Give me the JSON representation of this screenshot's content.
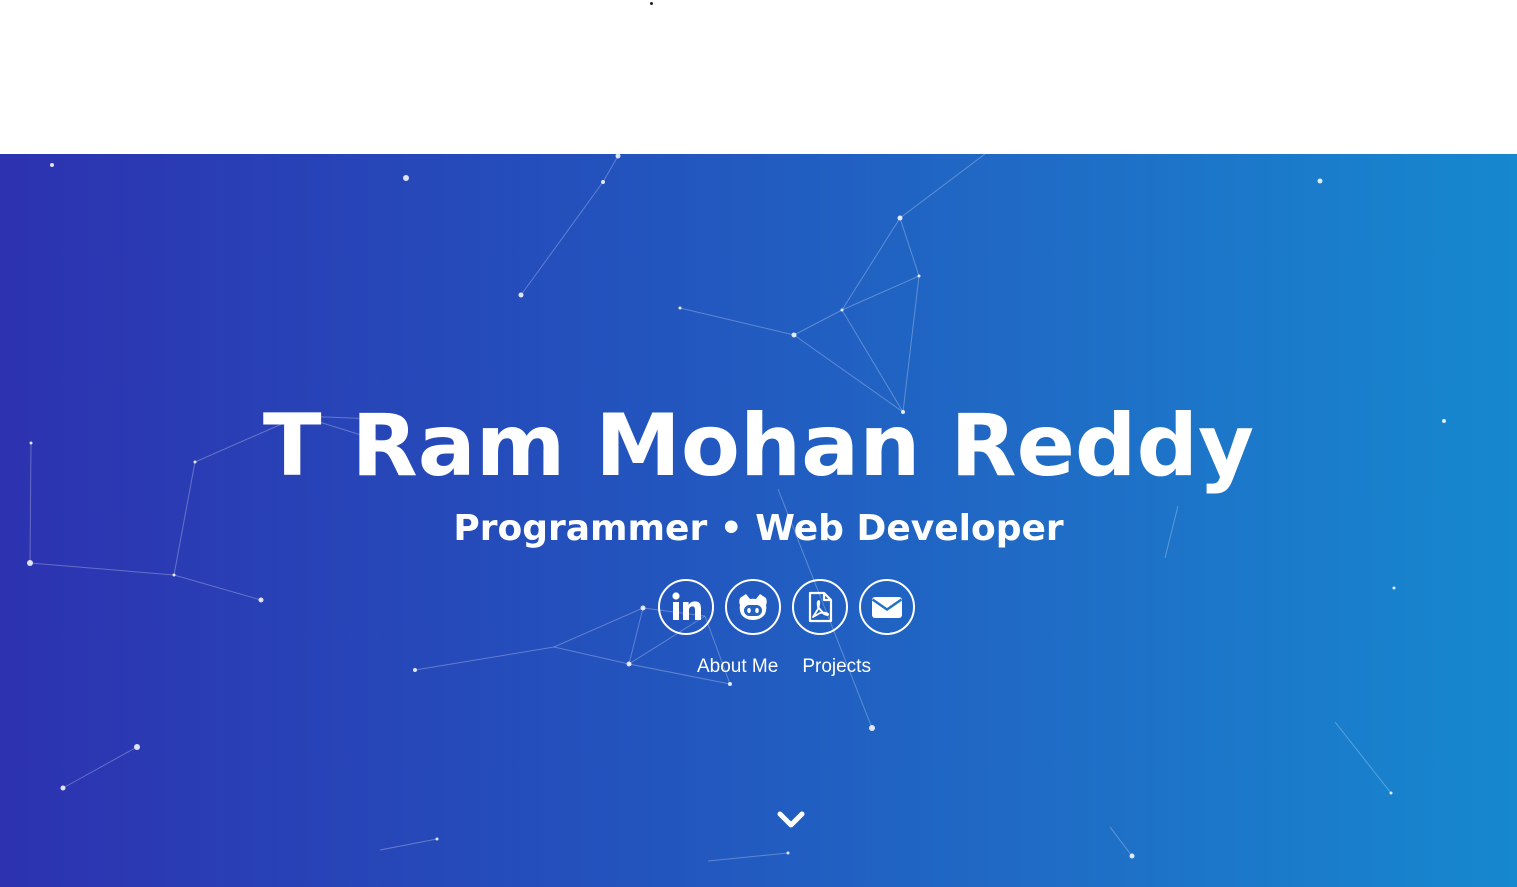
{
  "hero": {
    "name": "T Ram Mohan Reddy",
    "tagline": "Programmer • Web Developer"
  },
  "social": [
    {
      "name": "linkedin-icon"
    },
    {
      "name": "github-icon"
    },
    {
      "name": "pdf-resume-icon"
    },
    {
      "name": "envelope-icon"
    }
  ],
  "nav": {
    "about_label": "About Me",
    "projects_label": "Projects"
  },
  "scroll": {
    "icon": "chevron-down-icon"
  },
  "colors": {
    "gradient_start": "#2d32b0",
    "gradient_end": "#1688cf",
    "text": "#ffffff"
  }
}
